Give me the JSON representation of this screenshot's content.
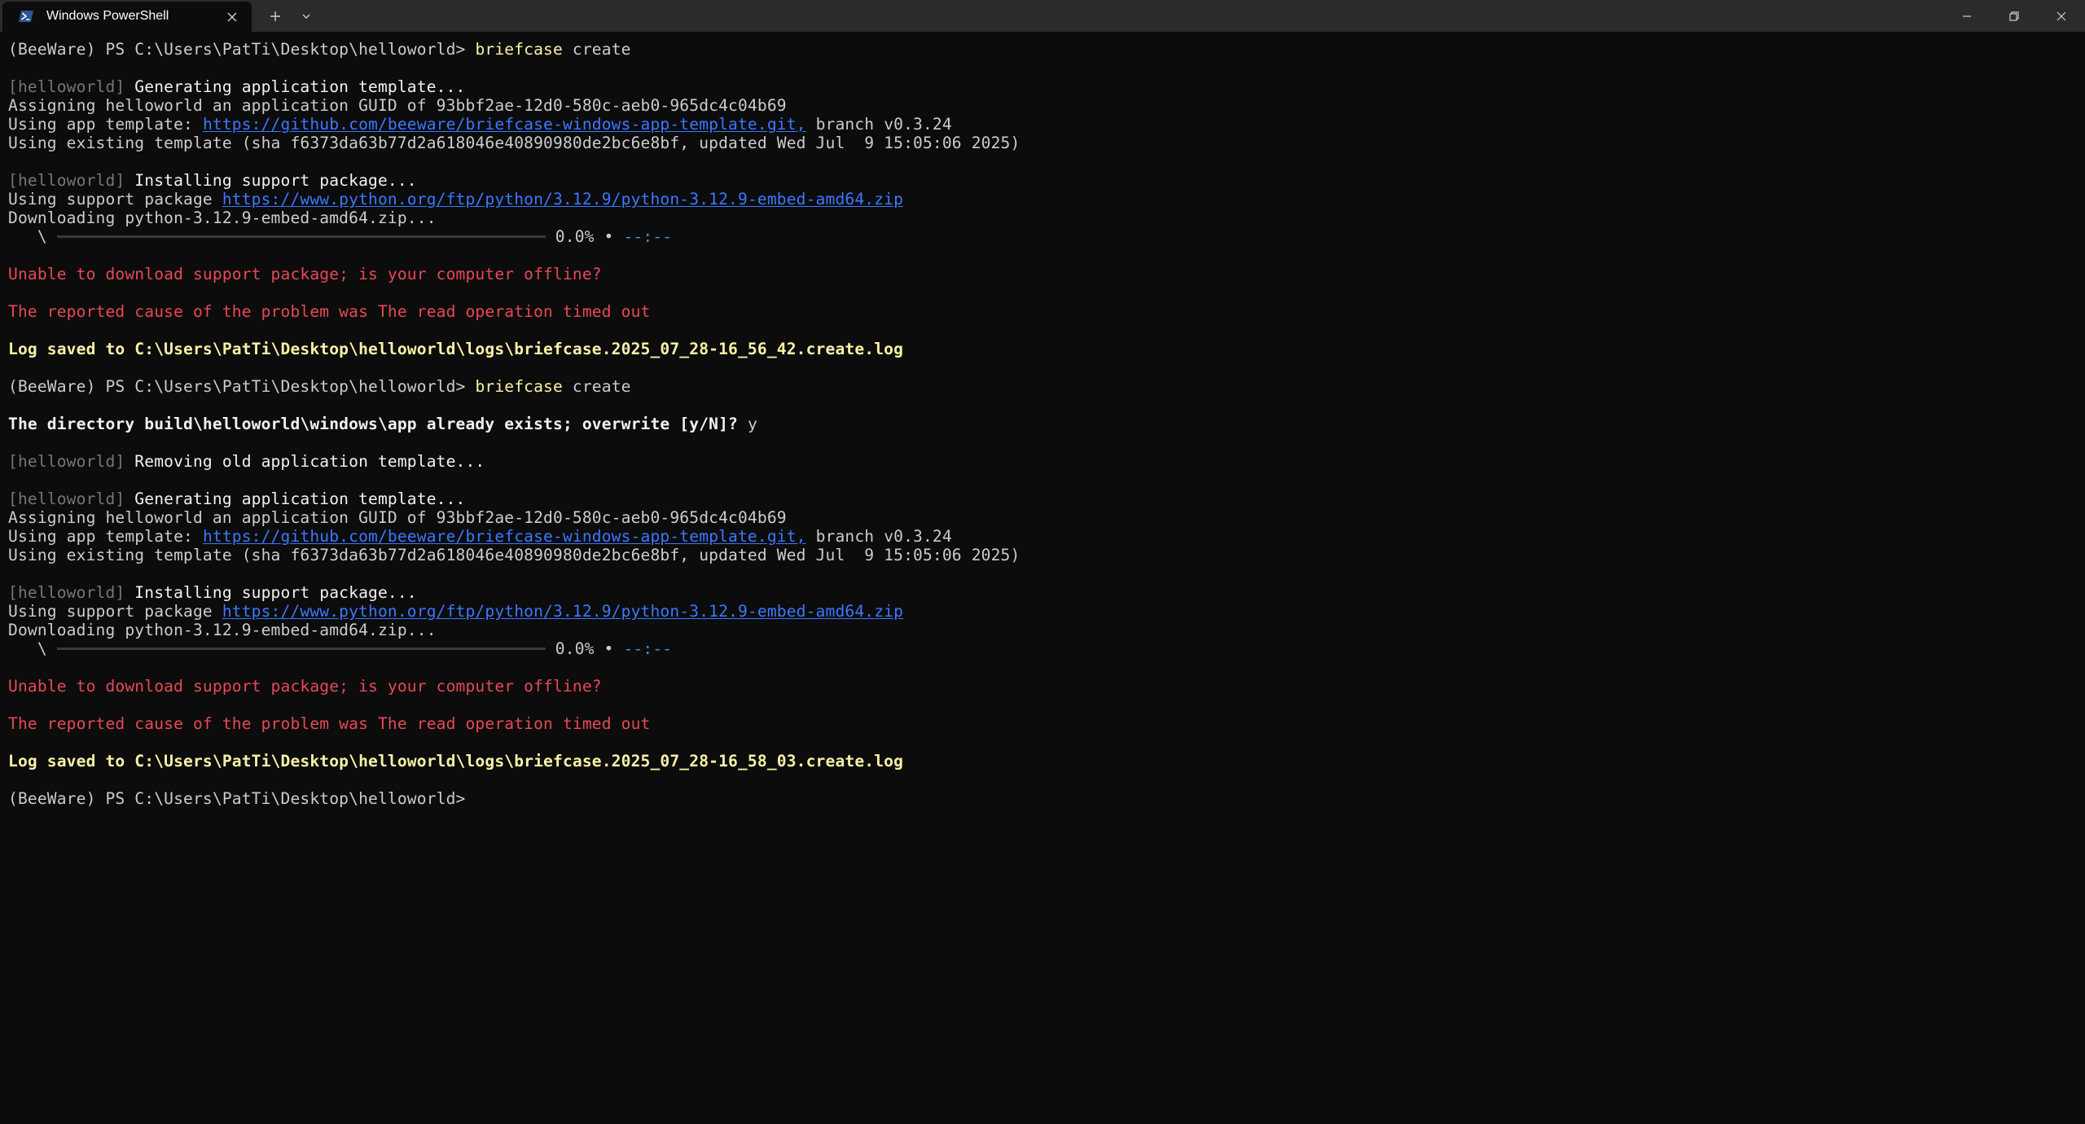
{
  "tab": {
    "title": "Windows PowerShell",
    "icon": "powershell-icon",
    "close_glyph": "✕",
    "new_tab_glyph": "+",
    "dropdown_glyph": "⌄"
  },
  "window_controls": {
    "minimize_glyph": "—",
    "restore_glyph": "❐",
    "close_glyph": "✕"
  },
  "colors": {
    "background": "#0c0c0c",
    "titlebar": "#2b2b2b",
    "text": "#cccccc",
    "dim": "#767676",
    "command": "#f9f1a5",
    "link": "#3b78ff",
    "error": "#e74856",
    "eta": "#3a96dd"
  },
  "terminal": {
    "prompt1": "(BeeWare) PS C:\\Users\\PatTi\\Desktop\\helloworld> ",
    "cmd1_name": "briefcase",
    "cmd1_arg": " create",
    "block1": {
      "tag_gen": "[helloworld]",
      "gen_text": " Generating application template...",
      "guid": "Assigning helloworld an application GUID of 93bbf2ae-12d0-580c-aeb0-965dc4c04b69",
      "tmpl_prefix": "Using app template: ",
      "tmpl_url": "https://github.com/beeware/briefcase-windows-app-template.git,",
      "tmpl_suffix": " branch v0.3.24",
      "existing": "Using existing template (sha f6373da63b77d2a618046e40890980de2bc6e8bf, updated Wed Jul  9 15:05:06 2025)",
      "tag_inst": "[helloworld]",
      "inst_text": " Installing support package...",
      "support_prefix": "Using support package ",
      "support_url": "https://www.python.org/ftp/python/3.12.9/python-3.12.9-embed-amd64.zip",
      "downloading": "Downloading python-3.12.9-embed-amd64.zip...",
      "spinner": "   \\",
      "progress_percent": "0.0%",
      "progress_sep": " • ",
      "progress_eta": "-:--",
      "progress_eta_prefix": "-",
      "error1": "Unable to download support package; is your computer offline?",
      "error2": "The reported cause of the problem was The read operation timed out",
      "log": "Log saved to C:\\Users\\PatTi\\Desktop\\helloworld\\logs\\briefcase.2025_07_28-16_56_42.create.log"
    },
    "prompt2": "(BeeWare) PS C:\\Users\\PatTi\\Desktop\\helloworld> ",
    "cmd2_name": "briefcase",
    "cmd2_arg": " create",
    "overwrite_q": "The directory build\\helloworld\\windows\\app already exists; overwrite [y/N]? ",
    "overwrite_a": "y",
    "tag_remove": "[helloworld]",
    "remove_text": " Removing old application template...",
    "block2": {
      "tag_gen": "[helloworld]",
      "gen_text": " Generating application template...",
      "guid": "Assigning helloworld an application GUID of 93bbf2ae-12d0-580c-aeb0-965dc4c04b69",
      "tmpl_prefix": "Using app template: ",
      "tmpl_url": "https://github.com/beeware/briefcase-windows-app-template.git,",
      "tmpl_suffix": " branch v0.3.24",
      "existing": "Using existing template (sha f6373da63b77d2a618046e40890980de2bc6e8bf, updated Wed Jul  9 15:05:06 2025)",
      "tag_inst": "[helloworld]",
      "inst_text": " Installing support package...",
      "support_prefix": "Using support package ",
      "support_url": "https://www.python.org/ftp/python/3.12.9/python-3.12.9-embed-amd64.zip",
      "downloading": "Downloading python-3.12.9-embed-amd64.zip...",
      "spinner": "   \\",
      "progress_percent": "0.0%",
      "progress_sep": " • ",
      "progress_eta": "-:--",
      "progress_eta_prefix": "-",
      "error1": "Unable to download support package; is your computer offline?",
      "error2": "The reported cause of the problem was The read operation timed out",
      "log": "Log saved to C:\\Users\\PatTi\\Desktop\\helloworld\\logs\\briefcase.2025_07_28-16_58_03.create.log"
    },
    "prompt3": "(BeeWare) PS C:\\Users\\PatTi\\Desktop\\helloworld>"
  }
}
